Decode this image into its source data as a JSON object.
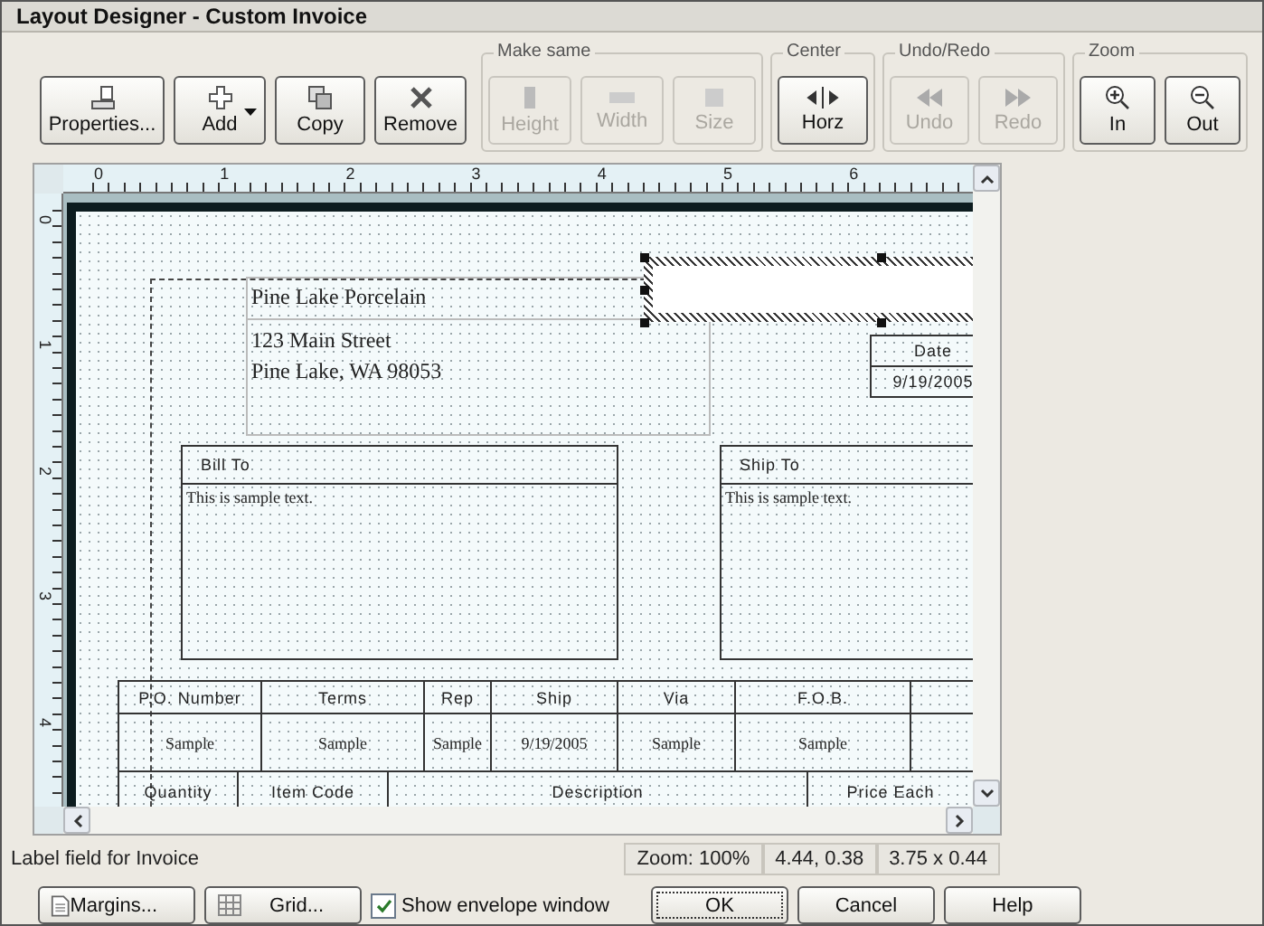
{
  "window": {
    "title": "Layout Designer - Custom Invoice"
  },
  "toolbar": {
    "groups": [
      {
        "buttons": [
          {
            "label": "Properties...",
            "disabled": false,
            "dropdown": false
          },
          {
            "label": "Add",
            "disabled": false,
            "dropdown": true
          },
          {
            "label": "Copy",
            "disabled": false,
            "dropdown": false
          },
          {
            "label": "Remove",
            "disabled": false,
            "dropdown": false
          }
        ]
      },
      {
        "label": "Make same",
        "buttons": [
          {
            "label": "Height",
            "disabled": true,
            "dropdown": false
          },
          {
            "label": "Width",
            "disabled": true,
            "dropdown": false
          },
          {
            "label": "Size",
            "disabled": true,
            "dropdown": false
          }
        ]
      },
      {
        "label": "Center",
        "buttons": [
          {
            "label": "Horz",
            "disabled": false,
            "dropdown": false
          }
        ]
      },
      {
        "label": "Undo/Redo",
        "buttons": [
          {
            "label": "Undo",
            "disabled": true,
            "dropdown": false
          },
          {
            "label": "Redo",
            "disabled": true,
            "dropdown": false
          }
        ]
      },
      {
        "label": "Zoom",
        "buttons": [
          {
            "label": "In",
            "disabled": false,
            "dropdown": false
          },
          {
            "label": "Out",
            "disabled": false,
            "dropdown": false
          }
        ]
      }
    ]
  },
  "rulers": {
    "horizontal": [
      "0",
      "1",
      "2",
      "3",
      "4",
      "5",
      "6"
    ],
    "vertical": [
      "0",
      "1",
      "2",
      "3",
      "4"
    ]
  },
  "canvas": {
    "company": {
      "name": "Pine Lake Porcelain",
      "address": [
        "123 Main Street",
        "Pine Lake, WA 98053"
      ]
    },
    "blank_field": {
      "selected": true
    },
    "date": {
      "header": "Date",
      "value": "9/19/2005"
    },
    "bill_to": {
      "title": "Bill To",
      "text": "This is sample text."
    },
    "ship_to": {
      "title": "Ship To",
      "text": "This is sample text."
    },
    "info_table": {
      "headers": [
        "P.O. Number",
        "Terms",
        "Rep",
        "Ship",
        "Via",
        "F.O.B."
      ],
      "values": [
        "Sample",
        "Sample",
        "Sample",
        "9/19/2005",
        "Sample",
        "Sample"
      ]
    },
    "items_table": {
      "headers": [
        "Quantity",
        "Item Code",
        "Description",
        "Price Each"
      ]
    }
  },
  "status_bar": {
    "message": "Label field for Invoice",
    "zoom": "Zoom: 100%",
    "position": "4.44, 0.38",
    "size": "3.75 x 0.44"
  },
  "footer": {
    "margins": "Margins...",
    "grid": "Grid...",
    "envelope": {
      "label": "Show envelope window",
      "checked": true
    },
    "buttons": [
      "OK",
      "Cancel",
      "Help"
    ]
  }
}
